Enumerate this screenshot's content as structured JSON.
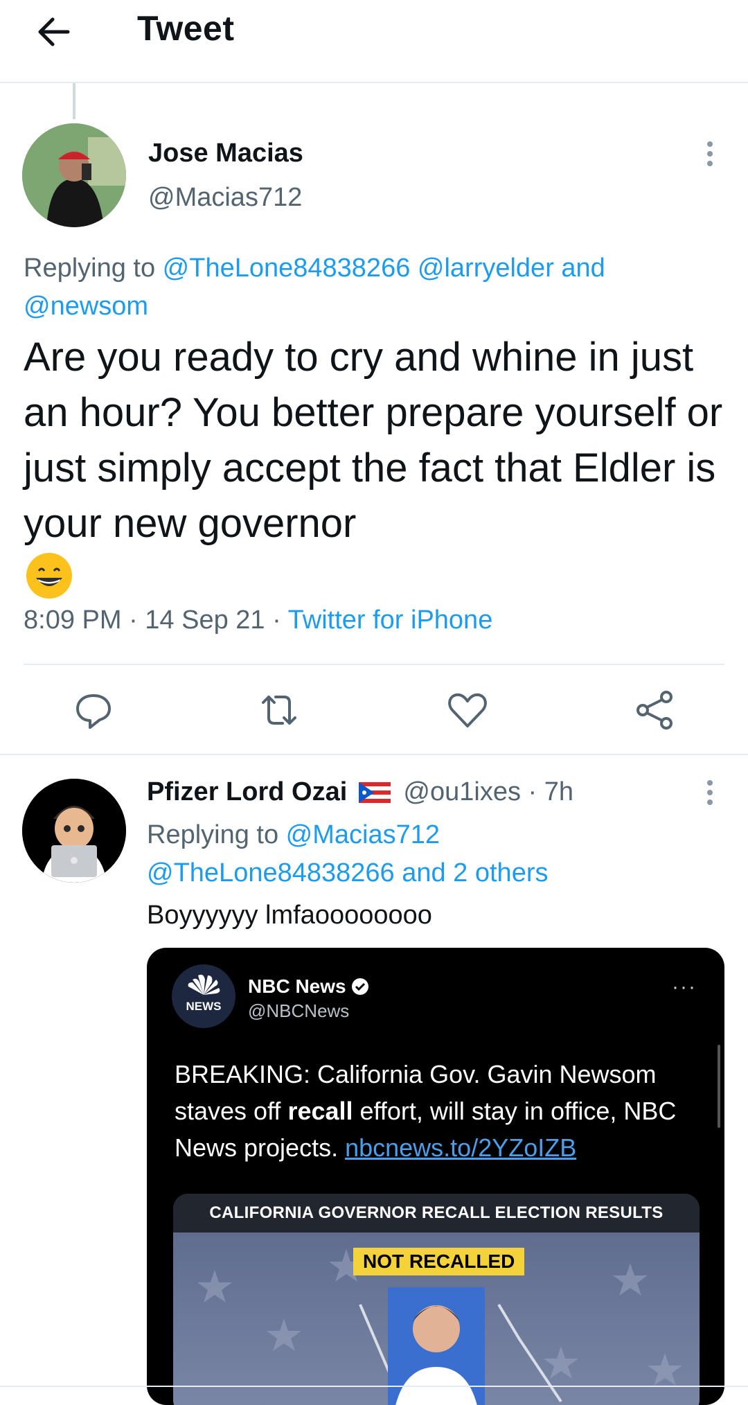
{
  "header": {
    "title": "Tweet"
  },
  "main_tweet": {
    "name": "Jose Macias",
    "handle": "@Macias712",
    "replying_prefix": "Replying to ",
    "replying_targets": "@TheLone84838266 @larryelder and",
    "replying_targets_2": "@newsom",
    "text": "Are you ready to cry and whine in just an hour? You better prepare yourself or just simply accept the fact that Eldler is your new governor",
    "emoji": "😁",
    "time": "8:09 PM · 14 Sep 21 · ",
    "source": "Twitter for iPhone"
  },
  "reply_tweet": {
    "name": "Pfizer Lord Ozai",
    "flag": "🇵🇷",
    "handle": "@ou1ixes · 7h",
    "replying_prefix": "Replying to ",
    "replying_target": "@Macias712",
    "replying_targets_2": "@TheLone84838266 and 2 others",
    "text": "Boyyyyyy lmfaoooooooo"
  },
  "embedded_card": {
    "logo_text": "NEWS",
    "name": "NBC News",
    "handle": "@NBCNews",
    "more": "···",
    "text_part1": "BREAKING: California Gov. Gavin Newsom staves off ",
    "text_bold": "recall",
    "text_part2": " effort, will stay in office, NBC News projects. ",
    "link": "nbcnews.to/2YZoIZB",
    "image_header": "CALIFORNIA GOVERNOR RECALL ELECTION RESULTS",
    "image_badge": "NOT RECALLED"
  },
  "colors": {
    "link": "#1d9bf0",
    "secondary": "#536471",
    "divider": "#e6ecf0"
  },
  "icons": [
    "back-arrow-icon",
    "more-vertical-icon",
    "reply-icon",
    "retweet-icon",
    "like-icon",
    "share-icon",
    "verified-icon"
  ]
}
